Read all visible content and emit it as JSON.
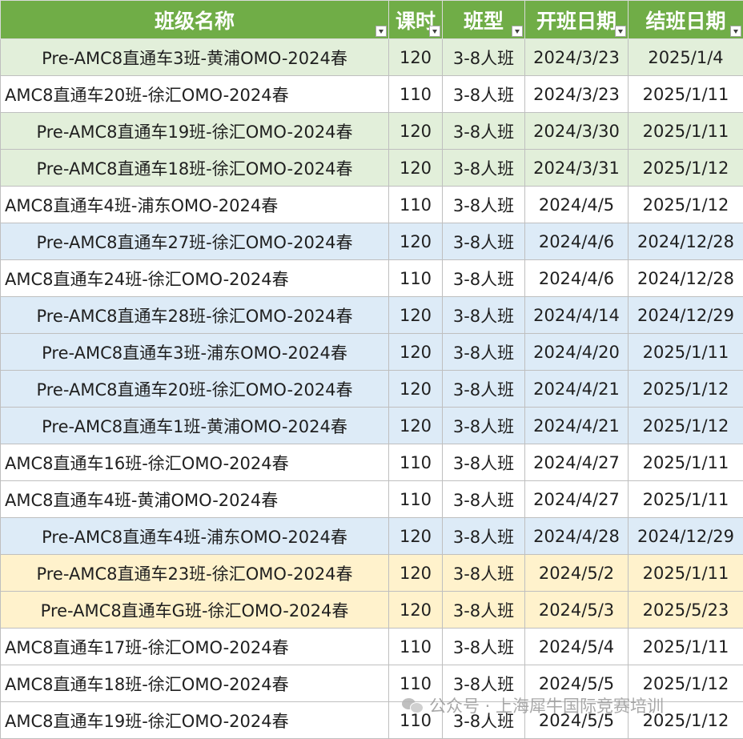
{
  "headers": [
    "班级名称",
    "课时",
    "班型",
    "开班日期",
    "结班日期"
  ],
  "rows": [
    {
      "name": "Pre-AMC8直通车3班-黄浦OMO-2024春",
      "hours": "120",
      "type": "3-8人班",
      "start": "2024/3/23",
      "end": "2025/1/4",
      "color": "green"
    },
    {
      "name": "AMC8直通车20班-徐汇OMO-2024春",
      "hours": "110",
      "type": "3-8人班",
      "start": "2024/3/23",
      "end": "2025/1/11",
      "color": "white"
    },
    {
      "name": "Pre-AMC8直通车19班-徐汇OMO-2024春",
      "hours": "120",
      "type": "3-8人班",
      "start": "2024/3/30",
      "end": "2025/1/11",
      "color": "green"
    },
    {
      "name": "Pre-AMC8直通车18班-徐汇OMO-2024春",
      "hours": "120",
      "type": "3-8人班",
      "start": "2024/3/31",
      "end": "2025/1/12",
      "color": "green"
    },
    {
      "name": "AMC8直通车4班-浦东OMO-2024春",
      "hours": "110",
      "type": "3-8人班",
      "start": "2024/4/5",
      "end": "2025/1/12",
      "color": "white"
    },
    {
      "name": "Pre-AMC8直通车27班-徐汇OMO-2024春",
      "hours": "120",
      "type": "3-8人班",
      "start": "2024/4/6",
      "end": "2024/12/28",
      "color": "blue"
    },
    {
      "name": "AMC8直通车24班-徐汇OMO-2024春",
      "hours": "110",
      "type": "3-8人班",
      "start": "2024/4/6",
      "end": "2024/12/28",
      "color": "white"
    },
    {
      "name": "Pre-AMC8直通车28班-徐汇OMO-2024春",
      "hours": "120",
      "type": "3-8人班",
      "start": "2024/4/14",
      "end": "2024/12/29",
      "color": "blue"
    },
    {
      "name": "Pre-AMC8直通车3班-浦东OMO-2024春",
      "hours": "120",
      "type": "3-8人班",
      "start": "2024/4/20",
      "end": "2025/1/11",
      "color": "blue"
    },
    {
      "name": "Pre-AMC8直通车20班-徐汇OMO-2024春",
      "hours": "120",
      "type": "3-8人班",
      "start": "2024/4/21",
      "end": "2025/1/12",
      "color": "blue"
    },
    {
      "name": "Pre-AMC8直通车1班-黄浦OMO-2024春",
      "hours": "120",
      "type": "3-8人班",
      "start": "2024/4/21",
      "end": "2025/1/12",
      "color": "blue"
    },
    {
      "name": "AMC8直通车16班-徐汇OMO-2024春",
      "hours": "110",
      "type": "3-8人班",
      "start": "2024/4/27",
      "end": "2025/1/11",
      "color": "white"
    },
    {
      "name": "AMC8直通车4班-黄浦OMO-2024春",
      "hours": "110",
      "type": "3-8人班",
      "start": "2024/4/27",
      "end": "2025/1/11",
      "color": "white"
    },
    {
      "name": "Pre-AMC8直通车4班-浦东OMO-2024春",
      "hours": "120",
      "type": "3-8人班",
      "start": "2024/4/28",
      "end": "2024/12/29",
      "color": "blue"
    },
    {
      "name": "Pre-AMC8直通车23班-徐汇OMO-2024春",
      "hours": "120",
      "type": "3-8人班",
      "start": "2024/5/2",
      "end": "2025/1/11",
      "color": "yellow"
    },
    {
      "name": "Pre-AMC8直通车G班-徐汇OMO-2024春",
      "hours": "120",
      "type": "3-8人班",
      "start": "2024/5/3",
      "end": "2025/5/23",
      "color": "yellow"
    },
    {
      "name": "AMC8直通车17班-徐汇OMO-2024春",
      "hours": "110",
      "type": "3-8人班",
      "start": "2024/5/4",
      "end": "2025/1/11",
      "color": "white"
    },
    {
      "name": "AMC8直通车18班-徐汇OMO-2024春",
      "hours": "110",
      "type": "3-8人班",
      "start": "2024/5/5",
      "end": "2025/1/12",
      "color": "white"
    },
    {
      "name": "AMC8直通车19班-徐汇OMO-2024春",
      "hours": "110",
      "type": "3-8人班",
      "start": "2024/5/5",
      "end": "2025/1/12",
      "color": "white"
    }
  ],
  "row_colors": {
    "green": "#e2efda",
    "blue": "#ddebf7",
    "yellow": "#fff2cc",
    "white": "#ffffff",
    "header": "#70ad47"
  },
  "watermark": "公众号 · 上海犀牛国际竞赛培训"
}
